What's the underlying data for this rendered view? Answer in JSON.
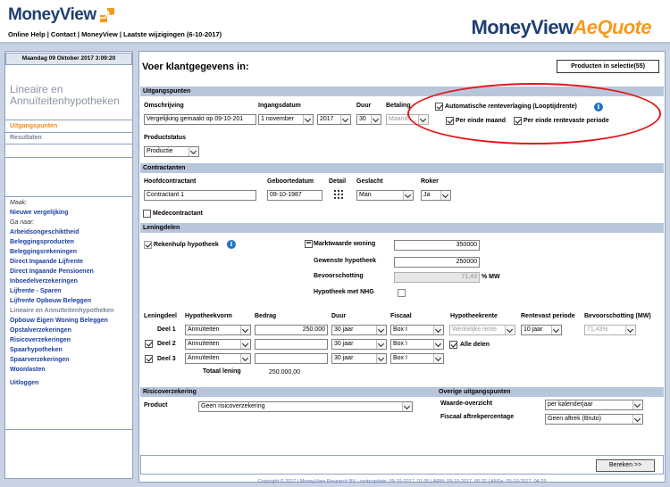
{
  "app": {
    "logo_left": "MoneyView",
    "brand_right_main": "MoneyView",
    "brand_right_accent": "AeQuote",
    "toplinks": "Online Help | Contact | MoneyView | Laatste wijzigingen (6-10-2017)"
  },
  "sidebar": {
    "datetime": "Maandag 09 Oktober 2017  3:09:20",
    "title": "Lineaire en Annuïteitenhypotheken",
    "active_item": "Uitgangspunten",
    "results_item": "Resultaten",
    "maak_label": "Maak:",
    "new_compare": "Nieuwe vergelijking",
    "ganaar_label": "Ga naar:",
    "nav": [
      "Arbeidsongeschiktheid",
      "Beleggingsproducten",
      "Beleggingsrekeningen",
      "Direct Ingaande Lijfrente",
      "Direct Ingaande Pensioenen",
      "Inboedelverzekeringen",
      "Lijfrente - Sparen",
      "Lijfrente Opbouw Beleggen",
      "Lineaire en Annuïteitenhypotheken",
      "Opbouw Eigen Woning Beleggen",
      "Opstalverzekeringen",
      "Risicoverzekeringen",
      "Spaarhypotheken",
      "Spaarverzekeringen",
      "Woonlasten"
    ],
    "logout": "Uitloggen"
  },
  "main": {
    "heading": "Voer klantgegevens in:",
    "products_button": "Producten in selectie(55)",
    "uitgangspunten": {
      "section": "Uitgangspunten",
      "omschrijving_label": "Omschrijving",
      "omschrijving_value": "Vergelijking gemaakt op 09-10-201",
      "ingangsdatum_label": "Ingangsdatum",
      "month_value": "1 november",
      "year_value": "2017",
      "duur_label": "Duur",
      "duur_value": "30",
      "betaling_label": "Betaling",
      "betaling_value": "Maand",
      "auto_rente_label": "Automatische renteverlaging (Looptijdrente)",
      "per_einde_maand": "Per einde maand",
      "per_einde_rentevast": "Per einde rentevaste periode",
      "productstatus_label": "Productstatus",
      "productstatus_value": "Productie"
    },
    "contractanten": {
      "section": "Contractanten",
      "hoofd_label": "Hoofdcontractant",
      "hoofd_value": "Contractant 1",
      "geboorte_label": "Geboortedatum",
      "geboorte_value": "09-10-1987",
      "detail_label": "Detail",
      "geslacht_label": "Geslacht",
      "geslacht_value": "Man",
      "roker_label": "Roker",
      "roker_value": "Ja",
      "mede_label": "Medecontractant"
    },
    "leningdelen": {
      "section": "Leningdelen",
      "rekenhulp_label": "Rekenhulp hypotheek",
      "marktwaarde_label": "Marktwaarde woning",
      "marktwaarde_value": "350000",
      "gewenste_label": "Gewenste hypotheek",
      "gewenste_value": "250000",
      "bevoorschotting_label": "Bevoorschotting",
      "bevoorschotting_value": "71,43",
      "mw_unit": "% MW",
      "nhg_label": "Hypotheek met NHG",
      "col_leningdeel": "Leningdeel",
      "col_vorm": "Hypotheekvorm",
      "col_bedrag": "Bedrag",
      "col_duur": "Duur",
      "col_fiscaal": "Fiscaal",
      "col_rente": "Hypotheekrente",
      "col_rentevast": "Rentevast periode",
      "col_bevoorschotting": "Bevoorschotting (MW)",
      "rows": [
        {
          "label": "Deel 1",
          "vorm": "Annuïteiten",
          "bedrag": "250.000",
          "duur": "30 jaar",
          "fiscaal": "Box I",
          "rente": "Werkelijke rente",
          "rentevast": "10 jaar",
          "bev": "71,43%"
        },
        {
          "label": "Deel 2",
          "vorm": "Annuïteiten",
          "bedrag": "",
          "duur": "30 jaar",
          "fiscaal": "Box I"
        },
        {
          "label": "Deel 3",
          "vorm": "Annuïteiten",
          "bedrag": "",
          "duur": "30 jaar",
          "fiscaal": "Box I"
        }
      ],
      "alle_delen": "Alle delen",
      "totaal_label": "Totaal lening",
      "totaal_value": "250.000,00"
    },
    "risico": {
      "section": "Risicoverzekering",
      "product_label": "Product",
      "product_value": "Geen risicoverzekering"
    },
    "overige": {
      "section": "Overige uitgangspunten",
      "waarde_label": "Waarde-overzicht",
      "waarde_value": "per kalenderjaar",
      "fiscaal_label": "Fiscaal aftrekpercentage",
      "fiscaal_value": "Geen aftrek (Bruto)"
    },
    "bereken": "Bereken >>",
    "footer": "Copyright © 2017 | MoneyView Research BV - renteupdate: 09-10-2017, 01:35 | ARM: 09-10-2017, 06:32 | ANSe: 09-10-2017, 04:29"
  },
  "colors": {
    "brand_blue": "#1f3f73",
    "brand_orange": "#f39b1f",
    "link_blue": "#1d3fa0",
    "section_bar": "#b8c6dc",
    "highlight_ellipse": "#e01818"
  }
}
